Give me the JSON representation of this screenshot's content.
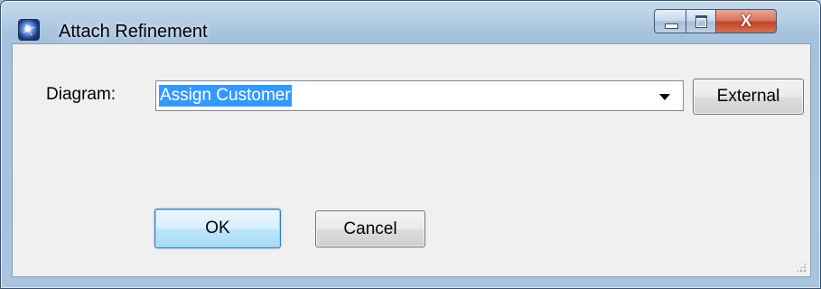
{
  "window": {
    "title": "Attach Refinement",
    "icon": "app-logo-icon",
    "controls": {
      "minimize": "minimize-icon",
      "maximize": "maximize-icon",
      "close_glyph": "X"
    }
  },
  "form": {
    "diagram_label": "Diagram:",
    "diagram_value": "Assign Customer",
    "dropdown_icon": "chevron-down-icon",
    "external_label": "External"
  },
  "buttons": {
    "ok_label": "OK",
    "cancel_label": "Cancel"
  },
  "colors": {
    "selection_highlight": "#3399ff",
    "close_button": "#c2442a",
    "default_button_border": "#3c7fb1"
  }
}
